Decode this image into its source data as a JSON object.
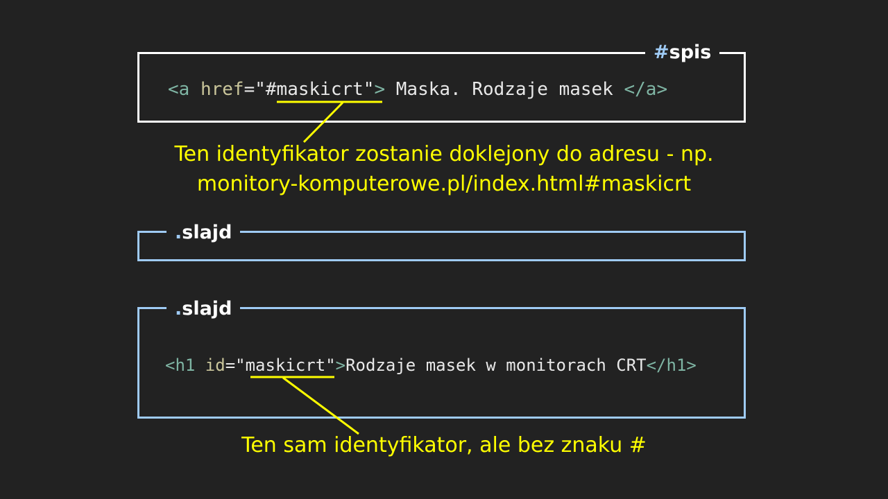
{
  "colors": {
    "background": "#222222",
    "white_frame": "#ffffff",
    "blue_frame": "#9fcbf5",
    "annotation": "#ffff00",
    "tag": "#7fb5a4",
    "attribute": "#c9c59a",
    "text": "#e8e8e8"
  },
  "box_spis": {
    "label_prefix": "#",
    "label_name": "spis",
    "code": {
      "open": "<a ",
      "attr": "href",
      "eq": "=",
      "q1": "\"",
      "value": "#maskicrt",
      "q2": "\"",
      "close": ">",
      "gap1": " ",
      "text": "Maska. Rodzaje masek",
      "gap2": " ",
      "end_tag": "</a>"
    }
  },
  "annotation_top": {
    "line1": "Ten identyfikator zostanie doklejony do adresu - np.",
    "line2": "monitory-komputerowe.pl/index.html#maskicrt"
  },
  "box_slajd_1": {
    "label_prefix": ".",
    "label_name": "slajd"
  },
  "box_slajd_2": {
    "label_prefix": ".",
    "label_name": "slajd",
    "code": {
      "open": "<h1 ",
      "attr": "id",
      "eq": "=",
      "q1": "\"",
      "value": "maskicrt",
      "q2": "\"",
      "close": ">",
      "text": "Rodzaje masek w monitorach CRT",
      "end_tag": "</h1>"
    }
  },
  "annotation_bottom": {
    "line1": "Ten sam identyfikator, ale bez znaku #"
  }
}
